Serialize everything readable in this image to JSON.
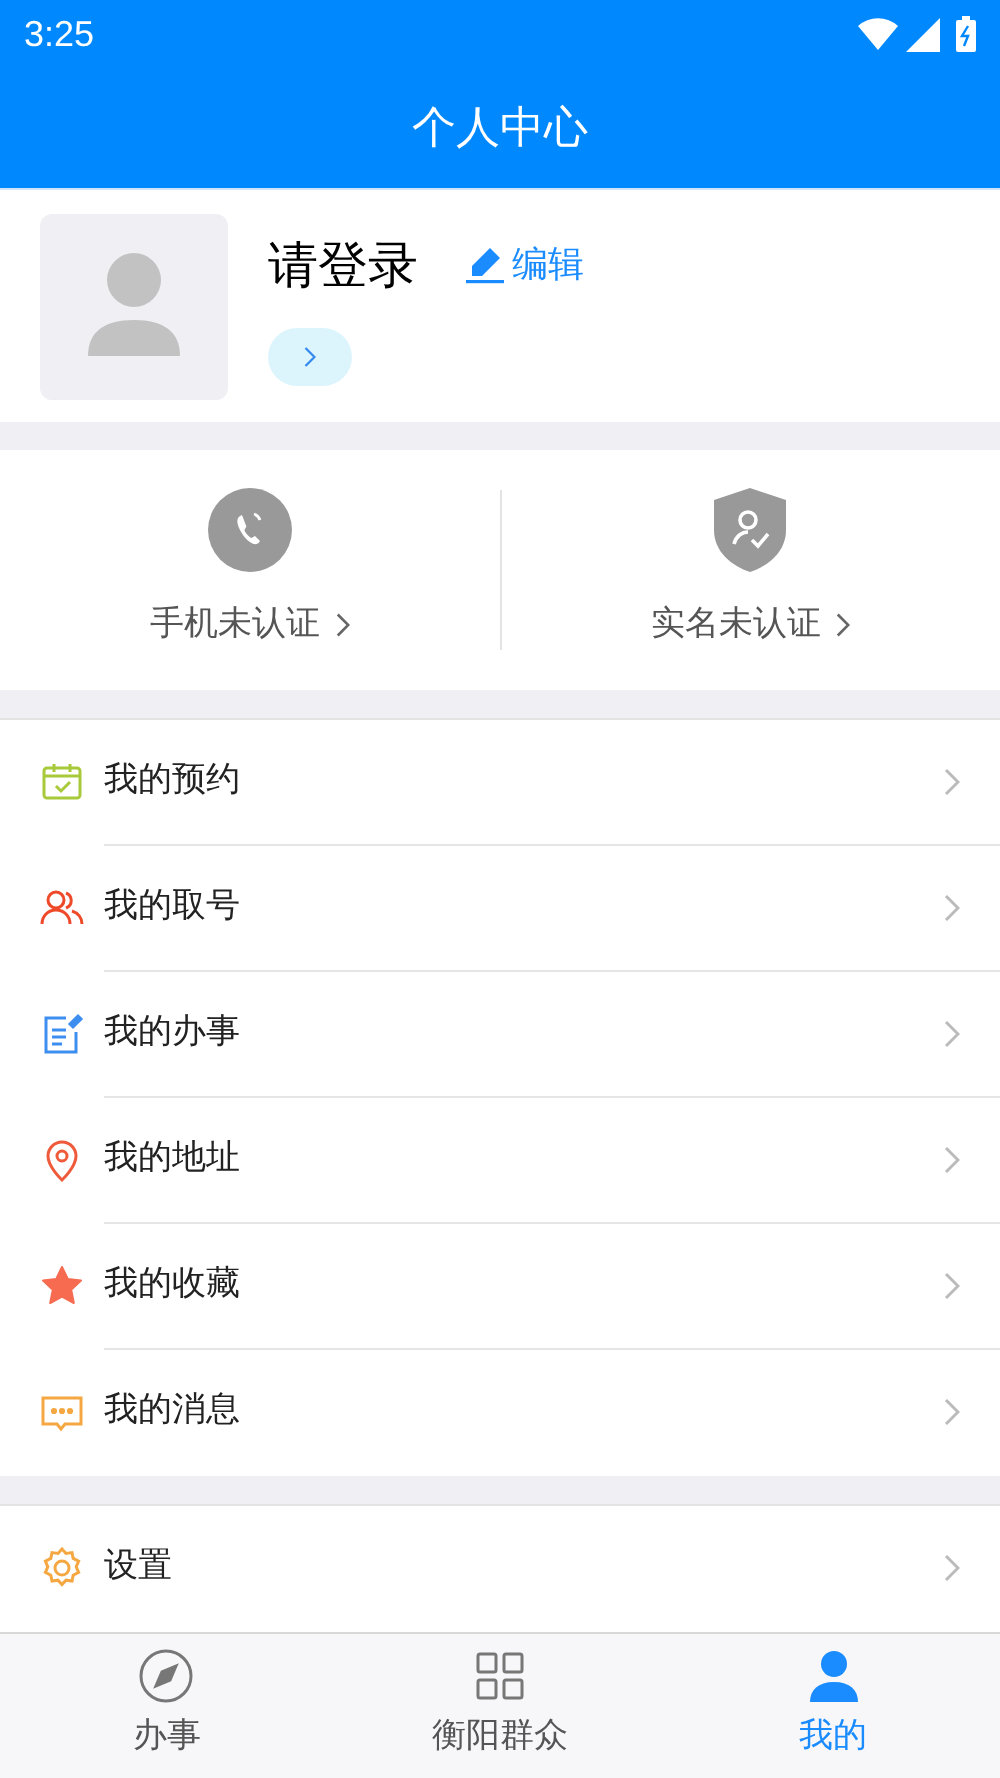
{
  "status_bar": {
    "time": "3:25"
  },
  "header": {
    "title": "个人中心"
  },
  "profile": {
    "name": "请登录",
    "edit_label": "编辑"
  },
  "verification": [
    {
      "kind": "phone",
      "label": "手机未认证"
    },
    {
      "kind": "identity",
      "label": "实名未认证"
    }
  ],
  "menu": [
    {
      "kind": "calendar",
      "label": "我的预约"
    },
    {
      "kind": "people",
      "label": "我的取号"
    },
    {
      "kind": "note",
      "label": "我的办事"
    },
    {
      "kind": "pin",
      "label": "我的地址"
    },
    {
      "kind": "star",
      "label": "我的收藏"
    },
    {
      "kind": "message",
      "label": "我的消息"
    }
  ],
  "settings": [
    {
      "kind": "gear",
      "label": "设置"
    }
  ],
  "tab_bar": [
    {
      "kind": "compass",
      "label": "办事",
      "selected": false
    },
    {
      "kind": "grid",
      "label": "衡阳群众",
      "selected": false
    },
    {
      "kind": "person",
      "label": "我的",
      "selected": true
    }
  ]
}
